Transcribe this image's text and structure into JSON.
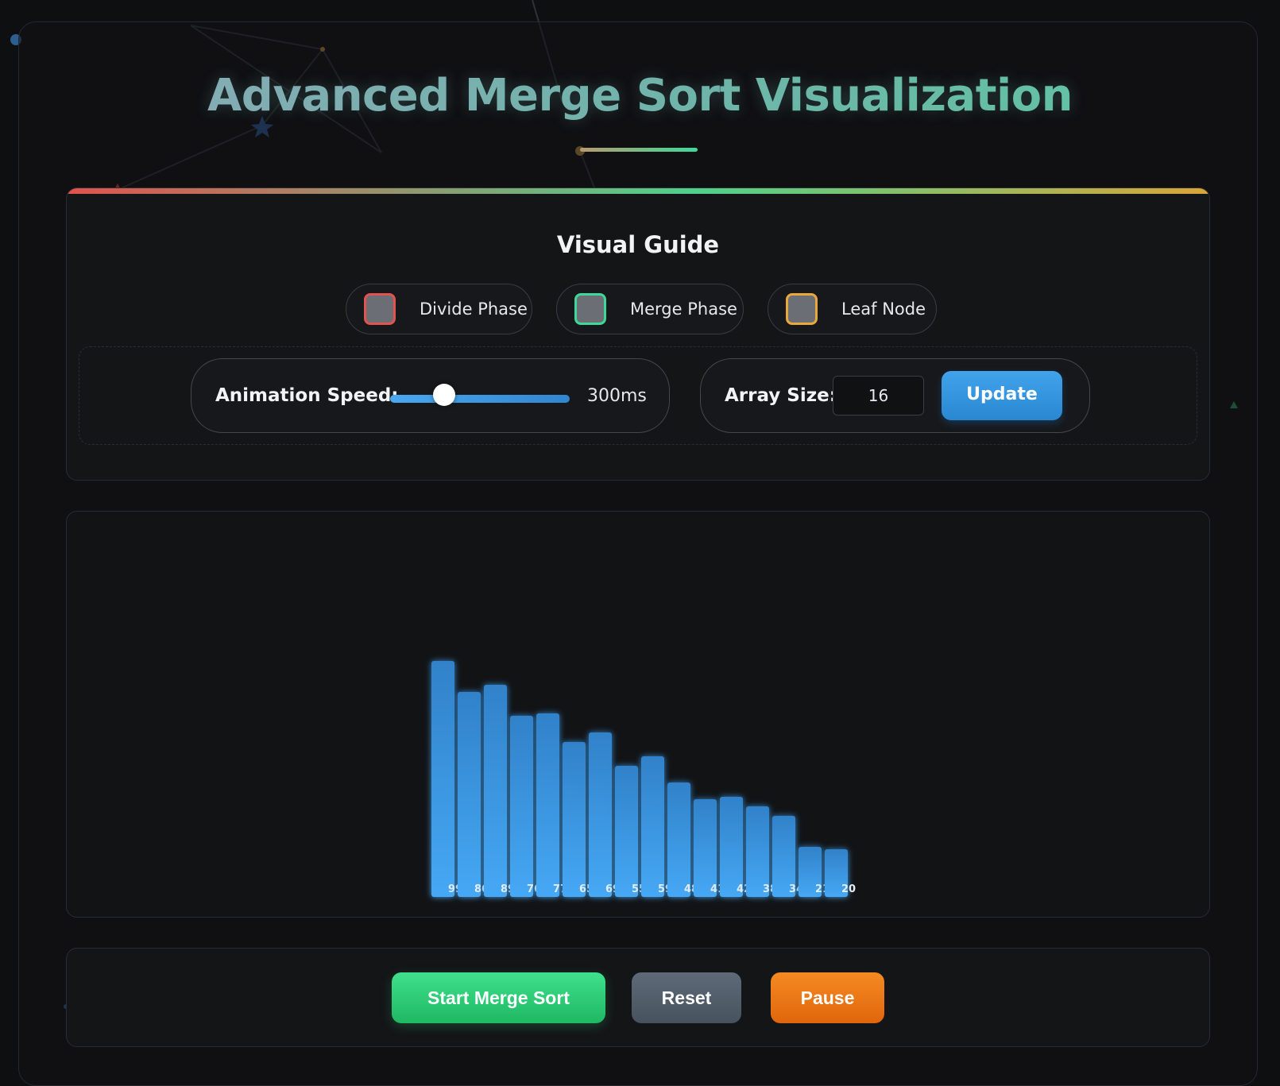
{
  "title": "Advanced Merge Sort Visualization",
  "visual_guide": {
    "heading": "Visual Guide",
    "legend": [
      {
        "label": "Divide Phase",
        "color": "#e0534e"
      },
      {
        "label": "Merge Phase",
        "color": "#3ed99a"
      },
      {
        "label": "Leaf Node",
        "color": "#e8a93a"
      }
    ]
  },
  "controls": {
    "speed_label": "Animation Speed:",
    "speed_value": "300ms",
    "speed_fraction": 0.3,
    "size_label": "Array Size:",
    "size_value": "16",
    "update_label": "Update"
  },
  "chart_data": {
    "type": "bar",
    "color": "#3b9be6",
    "values": [
      99,
      86,
      89,
      76,
      77,
      65,
      69,
      55,
      59,
      48,
      41,
      42,
      38,
      34,
      21,
      20
    ],
    "labels": [
      "99",
      "86",
      "89",
      "76",
      "77",
      "65",
      "69",
      "55",
      "59",
      "48",
      "41",
      "42",
      "38",
      "34",
      "21",
      "20"
    ]
  },
  "actions": {
    "start_label": "Start Merge Sort",
    "reset_label": "Reset",
    "pause_label": "Pause"
  }
}
